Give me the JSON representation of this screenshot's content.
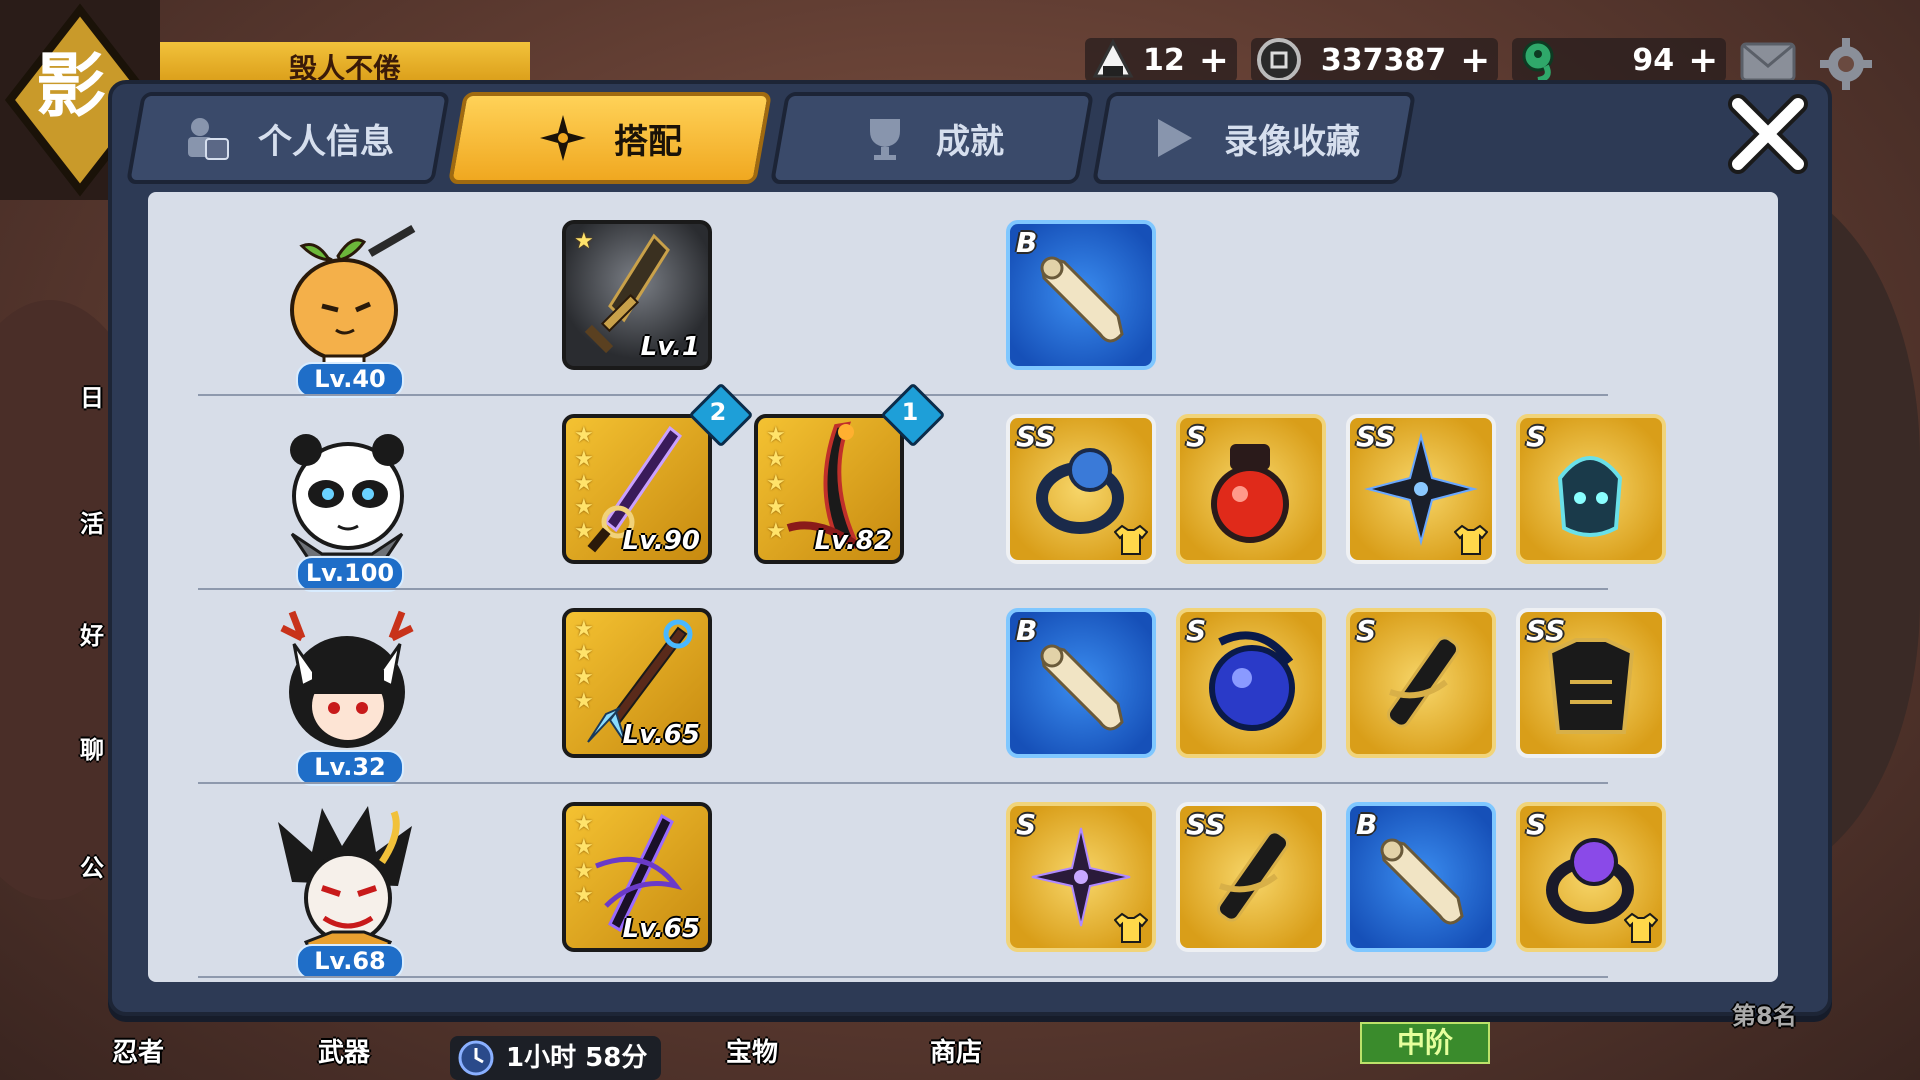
{
  "header": {
    "banner_text": "毁人不倦",
    "side_glyph": "影"
  },
  "resources": [
    {
      "name": "onigiri",
      "value": "12",
      "icon": "rice-ball-icon"
    },
    {
      "name": "coins",
      "value": "337387",
      "icon": "coin-icon"
    },
    {
      "name": "jade",
      "value": "94",
      "icon": "magatama-icon"
    }
  ],
  "tabs": [
    {
      "label": "个人信息",
      "icon": "profile-card-icon",
      "active": false
    },
    {
      "label": "搭配",
      "icon": "shuriken-icon",
      "active": true
    },
    {
      "label": "成就",
      "icon": "trophy-icon",
      "active": false
    },
    {
      "label": "录像收藏",
      "icon": "play-icon",
      "active": false
    }
  ],
  "rows": [
    {
      "level": "Lv.40",
      "avatar": "orange-ninja-avatar",
      "weapons": [
        {
          "name": "broadsword",
          "level": "Lv.1",
          "stars": 1,
          "style": "dark"
        }
      ],
      "equipment": [
        {
          "grade": "B",
          "item": "scroll",
          "frame": "blue"
        }
      ]
    },
    {
      "level": "Lv.100",
      "avatar": "panda-ninja-avatar",
      "weapons": [
        {
          "name": "purple-katana",
          "level": "Lv.90",
          "stars": 5,
          "gem": "2"
        },
        {
          "name": "red-scythe",
          "level": "Lv.82",
          "stars": 5,
          "gem": "1"
        }
      ],
      "equipment": [
        {
          "grade": "SS",
          "item": "blue-ring",
          "frame": "silver",
          "shirt": true
        },
        {
          "grade": "S",
          "item": "red-gourd",
          "frame": "gold"
        },
        {
          "grade": "SS",
          "item": "dark-shuriken",
          "frame": "silver",
          "shirt": true
        },
        {
          "grade": "S",
          "item": "spirit-lantern",
          "frame": "gold"
        }
      ]
    },
    {
      "level": "Lv.32",
      "avatar": "deer-girl-avatar",
      "weapons": [
        {
          "name": "ice-spear",
          "level": "Lv.65",
          "stars": 4
        }
      ],
      "equipment": [
        {
          "grade": "B",
          "item": "scroll",
          "frame": "blue"
        },
        {
          "grade": "S",
          "item": "blue-orb",
          "frame": "gold"
        },
        {
          "grade": "S",
          "item": "black-scroll",
          "frame": "gold"
        },
        {
          "grade": "SS",
          "item": "black-armor",
          "frame": "silver"
        }
      ]
    },
    {
      "level": "Lv.68",
      "avatar": "oni-mask-avatar",
      "weapons": [
        {
          "name": "shadow-blade",
          "level": "Lv.65",
          "stars": 4
        }
      ],
      "equipment": [
        {
          "grade": "S",
          "item": "purple-shuriken",
          "frame": "gold",
          "shirt": true
        },
        {
          "grade": "SS",
          "item": "black-scroll",
          "frame": "silver"
        },
        {
          "grade": "B",
          "item": "scroll",
          "frame": "blue"
        },
        {
          "grade": "S",
          "item": "purple-ring",
          "frame": "gold",
          "shirt": true
        }
      ]
    }
  ],
  "bottom_nav": {
    "ninja": "忍者",
    "weapon": "武器",
    "timer": "1小时 58分",
    "treasure": "宝物",
    "shop": "商店",
    "rank": "中阶",
    "rank_place": "第8名"
  },
  "side_labels": [
    "日",
    "活",
    "好",
    "聊",
    "公"
  ]
}
